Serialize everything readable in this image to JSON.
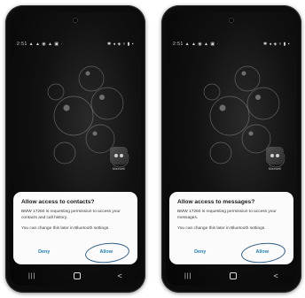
{
  "phones": [
    {
      "status_time": "2:51",
      "status_left_icons": "▲ ▲ ◉ ▲ ▣ ·",
      "status_right_icons": "✱ ◂ ◈ ▿ ▮ ▪",
      "app_label": "Maxwell",
      "dialog": {
        "title": "Allow access to contacts?",
        "body1": "BMW 17260 is requesting permission to access your contacts and call history.",
        "body2": "You can change this later in Bluetooth settings.",
        "deny": "Deny",
        "allow": "Allow"
      }
    },
    {
      "status_time": "2:51",
      "status_left_icons": "▲ ▲ ◉ ▲ ▣ ·",
      "status_right_icons": "✱ ◂ ◈ ▿ ▮ ▪",
      "app_label": "Maxwell",
      "dialog": {
        "title": "Allow access to messages?",
        "body1": "BMW 17260 is requesting permission to access your messages.",
        "body2": "You can change this later in Bluetooth settings.",
        "deny": "Deny",
        "allow": "Allow"
      }
    }
  ],
  "navbar": {
    "recents": "|||",
    "back": "<"
  },
  "colors": {
    "accent": "#1f7fb0",
    "annotation_circle": "#2e5f86",
    "dialog_bg": "#fbfbfb"
  }
}
